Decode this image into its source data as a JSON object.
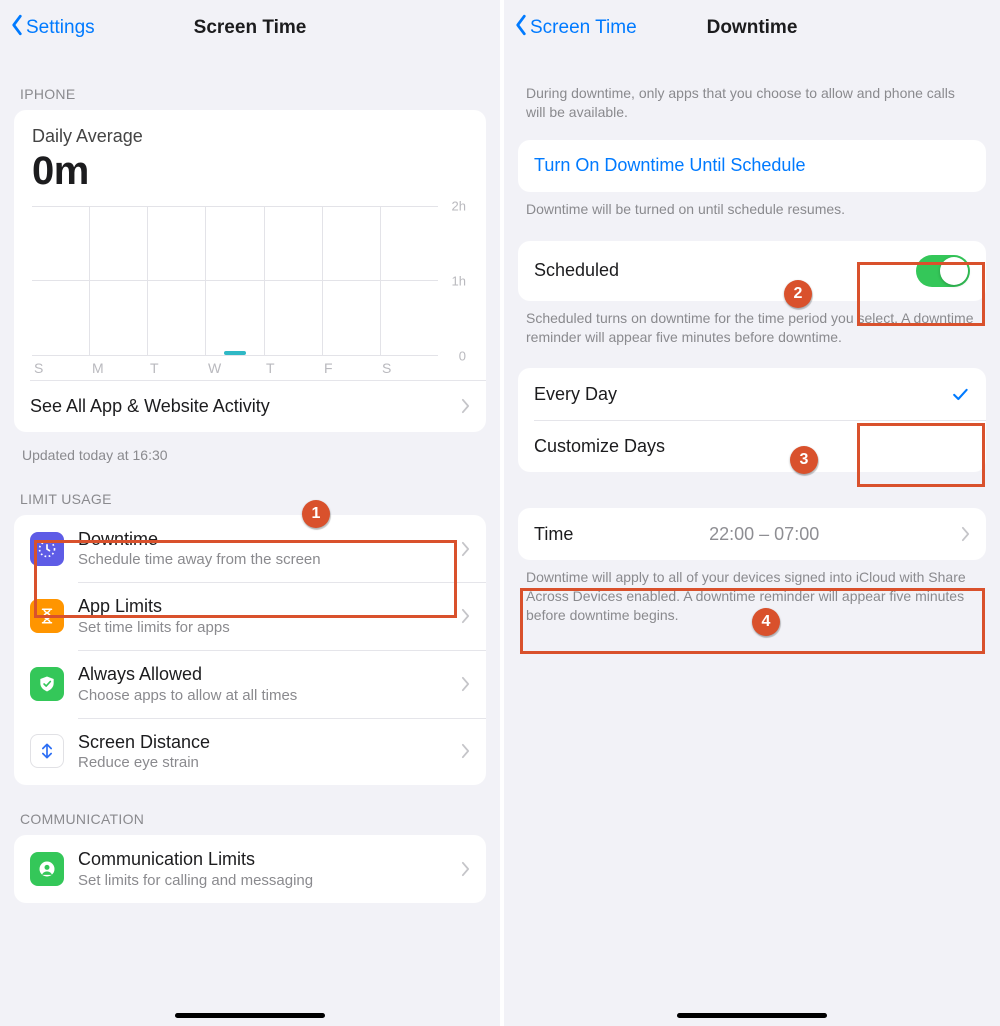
{
  "left": {
    "back_label": "Settings",
    "title": "Screen Time",
    "section_iphone": "IPHONE",
    "daily_avg_label": "Daily Average",
    "daily_avg_value": "0m",
    "see_all": "See All App & Website Activity",
    "updated": "Updated today at 16:30",
    "section_limit": "LIMIT USAGE",
    "items": [
      {
        "title": "Downtime",
        "sub": "Schedule time away from the screen"
      },
      {
        "title": "App Limits",
        "sub": "Set time limits for apps"
      },
      {
        "title": "Always Allowed",
        "sub": "Choose apps to allow at all times"
      },
      {
        "title": "Screen Distance",
        "sub": "Reduce eye strain"
      }
    ],
    "section_comm": "COMMUNICATION",
    "comm_item": {
      "title": "Communication Limits",
      "sub": "Set limits for calling and messaging"
    }
  },
  "right": {
    "back_label": "Screen Time",
    "title": "Downtime",
    "intro": "During downtime, only apps that you choose to allow and phone calls will be available.",
    "turn_on": "Turn On Downtime Until Schedule",
    "turn_on_foot": "Downtime will be turned on until schedule resumes.",
    "scheduled_label": "Scheduled",
    "scheduled_foot": "Scheduled turns on downtime for the time period you select. A downtime reminder will appear five minutes before downtime.",
    "every_day": "Every Day",
    "customize": "Customize Days",
    "time_label": "Time",
    "time_value": "22:00 – 07:00",
    "time_foot": "Downtime will apply to all of your devices signed into iCloud with Share Across Devices enabled. A downtime reminder will appear five minutes before downtime begins."
  },
  "chart_data": {
    "type": "bar",
    "categories": [
      "S",
      "M",
      "T",
      "W",
      "T",
      "F",
      "S"
    ],
    "values": [
      0,
      0,
      0,
      0.05,
      0,
      0,
      0
    ],
    "ylabels": [
      "2h",
      "1h",
      "0"
    ],
    "ylim": [
      0,
      2
    ],
    "title": "Daily Average",
    "big_value": "0m"
  },
  "annotations": {
    "1": "1",
    "2": "2",
    "3": "3",
    "4": "4"
  }
}
